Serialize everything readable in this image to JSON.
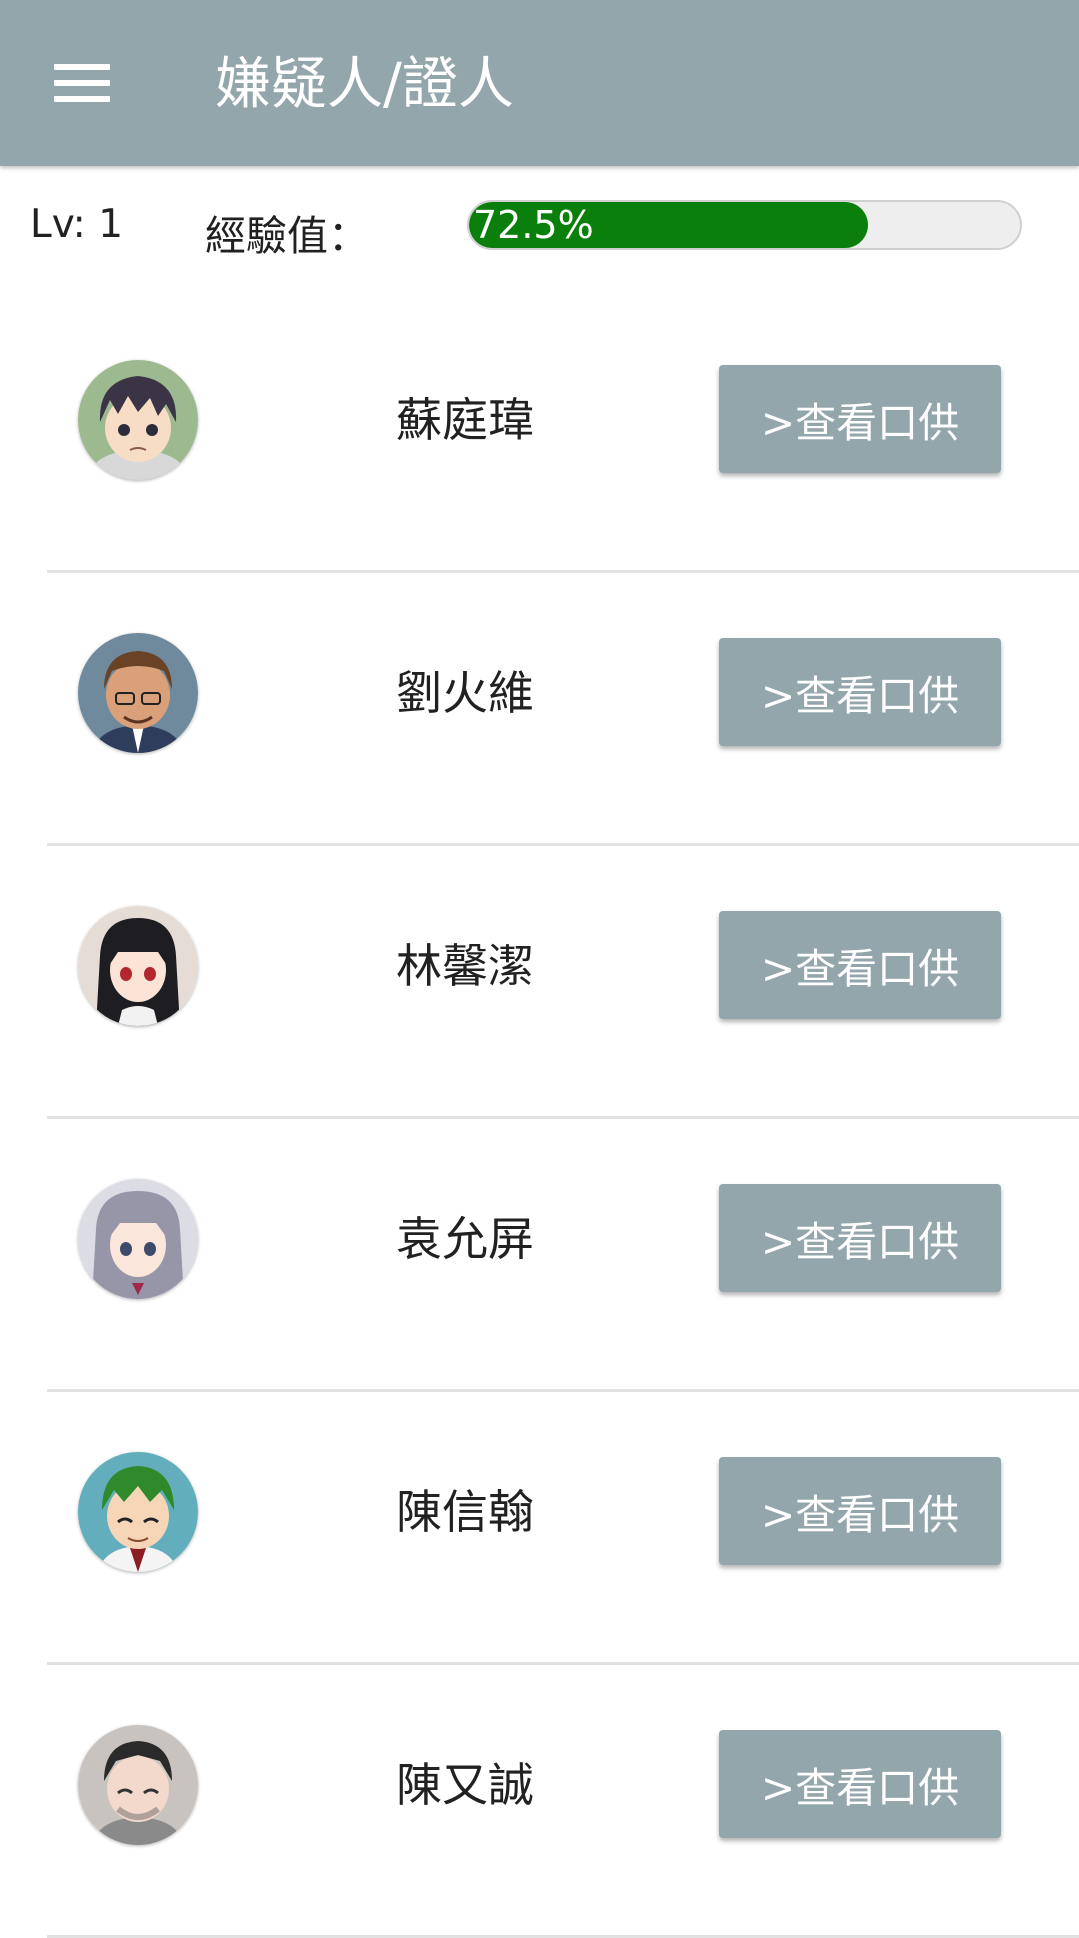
{
  "header": {
    "title": "嫌疑人/證人",
    "menu_icon": "hamburger-menu-icon"
  },
  "status": {
    "level_text": "Lv: 1",
    "exp_label": "經驗值：",
    "exp_progress": 72.5,
    "exp_text": "72.5%",
    "progress_color": "#0b7f0b"
  },
  "colors": {
    "appbar": "#93a6ab",
    "button": "#93a6ab"
  },
  "people": [
    {
      "name": "蘇庭瑋",
      "button_label": ">查看口供"
    },
    {
      "name": "劉火維",
      "button_label": ">查看口供"
    },
    {
      "name": "林馨潔",
      "button_label": ">查看口供"
    },
    {
      "name": "袁允屏",
      "button_label": ">查看口供"
    },
    {
      "name": "陳信翰",
      "button_label": ">查看口供"
    },
    {
      "name": "陳又誠",
      "button_label": ">查看口供"
    }
  ]
}
